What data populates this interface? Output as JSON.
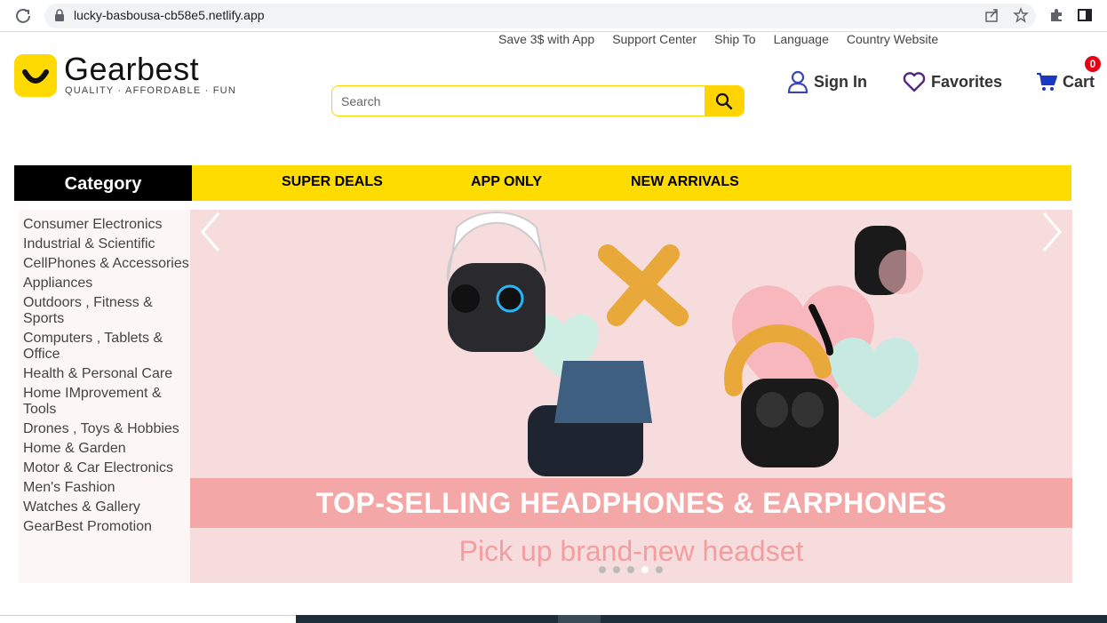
{
  "browser": {
    "url": "lucky-basbousa-cb58e5.netlify.app",
    "icons": [
      "reload-icon",
      "lock-icon",
      "share-icon",
      "star-icon",
      "extensions-icon",
      "sidepanel-icon"
    ]
  },
  "top_links": [
    "Save 3$ with App",
    "Support Center",
    "Ship To",
    "Language",
    "Country Website"
  ],
  "logo": {
    "name": "Gearbest",
    "tagline": "QUALITY · AFFORDABLE · FUN",
    "color": "#ffda00"
  },
  "search": {
    "placeholder": "Search",
    "value": ""
  },
  "account": {
    "sign_in": "Sign In",
    "favorites": "Favorites",
    "cart": "Cart",
    "cart_count": "0"
  },
  "nav": {
    "category": "Category",
    "items": [
      "SUPER DEALS",
      "APP ONLY",
      "NEW ARRIVALS"
    ],
    "accent": "#ffdc00"
  },
  "categories": [
    "Consumer Electronics",
    "Industrial & Scientific",
    "CellPhones & Accessories",
    "Appliances",
    "Outdoors , Fitness & Sports",
    "Computers , Tablets & Office",
    "Health & Personal Care",
    "Home IMprovement & Tools",
    "Drones , Toys & Hobbies",
    "Home & Garden",
    "Motor & Car Electronics",
    "Men's Fashion",
    "Watches & Gallery",
    "GearBest Promotion"
  ],
  "banner": {
    "title": "TOP-SELLING HEADPHONES & EARPHONES",
    "subtitle": "Pick up brand-new headset",
    "slide_count": 5,
    "active_slide": 4
  }
}
